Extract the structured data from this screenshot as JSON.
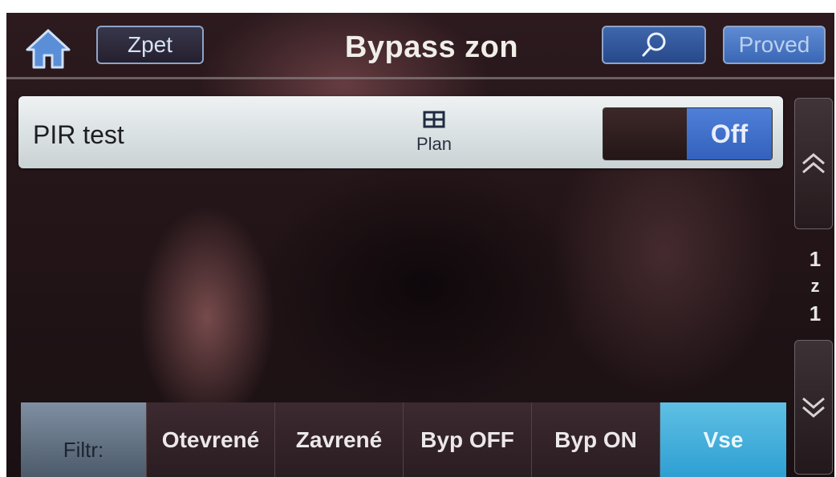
{
  "header": {
    "title": "Bypass zon",
    "back_label": "Zpet",
    "confirm_label": "Proved"
  },
  "zone": {
    "name": "PIR test",
    "plan_label": "Plan",
    "toggle_label": "Off"
  },
  "pager": {
    "current": "1",
    "sep": "z",
    "total": "1"
  },
  "filter": {
    "label": "Filtr:",
    "options": [
      "Otevrené",
      "Zavrené",
      "Byp OFF",
      "Byp ON",
      "Vse"
    ],
    "active": "Vse"
  },
  "colors": {
    "accent": "#2e9fd3",
    "toggle_blue": "#3a67b5",
    "header_btn_border": "#8fa4c8"
  }
}
